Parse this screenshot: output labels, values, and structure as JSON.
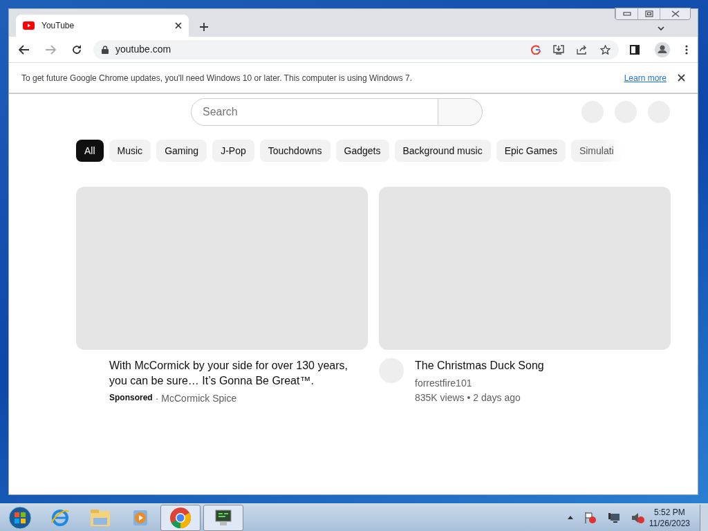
{
  "browser": {
    "tab": {
      "title": "YouTube"
    },
    "address": "youtube.com"
  },
  "infobar": {
    "message": "To get future Google Chrome updates, you'll need Windows 10 or later. This computer is using Windows 7.",
    "link": "Learn more"
  },
  "youtube": {
    "search": {
      "placeholder": "Search"
    },
    "chips": [
      {
        "label": "All",
        "selected": true
      },
      {
        "label": "Music",
        "selected": false
      },
      {
        "label": "Gaming",
        "selected": false
      },
      {
        "label": "J-Pop",
        "selected": false
      },
      {
        "label": "Touchdowns",
        "selected": false
      },
      {
        "label": "Gadgets",
        "selected": false
      },
      {
        "label": "Background music",
        "selected": false
      },
      {
        "label": "Epic Games",
        "selected": false
      },
      {
        "label": "Simulati",
        "selected": false
      }
    ],
    "videos": [
      {
        "kind": "ad",
        "title": "With McCormick by your side for over 130 years, you can be sure… It’s Gonna Be Great™.",
        "sponsored": "Sponsored",
        "separator": "·",
        "advertiser": "McCormick Spice"
      },
      {
        "kind": "video",
        "title": "The Christmas Duck Song",
        "channel": "forrestfire101",
        "meta": "835K views • 2 days ago"
      }
    ]
  },
  "taskbar": {
    "time": "5:52 PM",
    "date": "11/26/2023"
  }
}
